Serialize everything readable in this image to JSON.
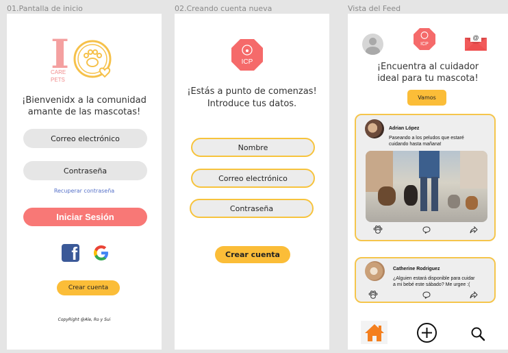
{
  "frames": {
    "login_label": "01.Pantalla de inicio",
    "signup_label": "02.Creando cuenta nueva",
    "feed_label": "Vista del Feed"
  },
  "login": {
    "logo_letter": "I",
    "logo_care": "CARE",
    "logo_pets": "PETS",
    "welcome_line1": "¡Bienvenidx a la comunidad",
    "welcome_line2": "amante de las mascotas!",
    "email_label": "Correo electrónico",
    "password_label": "Contraseña",
    "recover_label": "Recuperar contraseña",
    "login_button": "Iniciar Sesión",
    "create_account_button": "Crear cuenta",
    "copyright": "CopyRight @Ale, Ro y Sui",
    "colors": {
      "login_button": "#f87876",
      "link": "#5570c8",
      "yellow": "#fbbd38"
    }
  },
  "signup": {
    "badge_text": "ICP",
    "intro_line1": "¡Estás a punto de comenzas!",
    "intro_line2": "Introduce tus datos.",
    "name_label": "Nombre",
    "email_label": "Correo electrónico",
    "password_label": "Contraseña",
    "create_button": "Crear cuenta"
  },
  "feed": {
    "badge_text": "ICP",
    "headline_line1": "¡Encuentra al cuidador",
    "headline_line2": "ideal para tu mascota!",
    "cta_button": "Vamos",
    "posts": [
      {
        "author": "Adrian López",
        "text_line1": "Paseando  a los peludos que estaré",
        "text_line2": "cuidando hasta mañana!"
      },
      {
        "author": "Catherine Rodriguez",
        "text_line1": "¿Alguien estará disponible para cuidar",
        "text_line2": "a mi bebé este sábado? Me urgee :("
      }
    ],
    "colors": {
      "badge": "#f56a6a",
      "accent": "#f5c54b"
    }
  }
}
